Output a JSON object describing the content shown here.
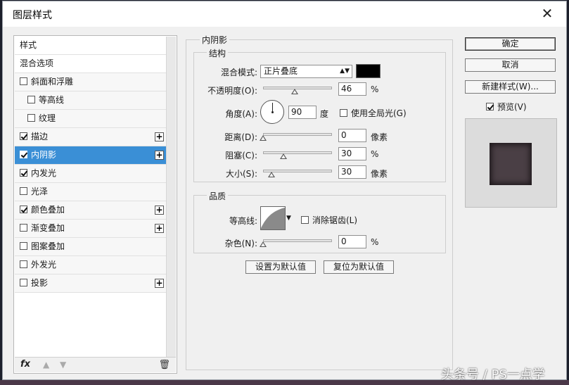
{
  "dialog": {
    "title": "图层样式",
    "close_label": "✕"
  },
  "styles": {
    "items": [
      {
        "label": "样式",
        "checkbox": false,
        "checked": false,
        "plus": false,
        "indent": false,
        "header": true
      },
      {
        "label": "混合选项",
        "checkbox": false,
        "checked": false,
        "plus": false,
        "indent": false,
        "header": true
      },
      {
        "label": "斜面和浮雕",
        "checkbox": true,
        "checked": false,
        "plus": false,
        "indent": false
      },
      {
        "label": "等高线",
        "checkbox": true,
        "checked": false,
        "plus": false,
        "indent": true
      },
      {
        "label": "纹理",
        "checkbox": true,
        "checked": false,
        "plus": false,
        "indent": true
      },
      {
        "label": "描边",
        "checkbox": true,
        "checked": true,
        "plus": true,
        "indent": false
      },
      {
        "label": "内阴影",
        "checkbox": true,
        "checked": true,
        "plus": true,
        "indent": false,
        "selected": true
      },
      {
        "label": "内发光",
        "checkbox": true,
        "checked": true,
        "plus": false,
        "indent": false
      },
      {
        "label": "光泽",
        "checkbox": true,
        "checked": false,
        "plus": false,
        "indent": false
      },
      {
        "label": "颜色叠加",
        "checkbox": true,
        "checked": true,
        "plus": true,
        "indent": false
      },
      {
        "label": "渐变叠加",
        "checkbox": true,
        "checked": false,
        "plus": true,
        "indent": false
      },
      {
        "label": "图案叠加",
        "checkbox": true,
        "checked": false,
        "plus": false,
        "indent": false
      },
      {
        "label": "外发光",
        "checkbox": true,
        "checked": false,
        "plus": false,
        "indent": false
      },
      {
        "label": "投影",
        "checkbox": true,
        "checked": false,
        "plus": true,
        "indent": false
      }
    ],
    "footer_fx": "fx"
  },
  "inner_shadow": {
    "section_title": "内阴影",
    "structure": {
      "title": "结构",
      "blend_mode_label": "混合模式:",
      "blend_mode_value": "正片叠底",
      "opacity_label": "不透明度(O):",
      "opacity_value": "46",
      "opacity_unit": "%",
      "opacity_slider": 0.46,
      "angle_label": "角度(A):",
      "angle_value": "90",
      "angle_unit": "度",
      "global_light_label": "使用全局光(G)",
      "distance_label": "距离(D):",
      "distance_value": "0",
      "distance_unit": "像素",
      "distance_slider": 0.0,
      "choke_label": "阻塞(C):",
      "choke_value": "30",
      "choke_unit": "%",
      "choke_slider": 0.3,
      "size_label": "大小(S):",
      "size_value": "30",
      "size_unit": "像素",
      "size_slider": 0.12
    },
    "quality": {
      "title": "品质",
      "contour_label": "等高线:",
      "anti_alias_label": "消除锯齿(L)",
      "noise_label": "杂色(N):",
      "noise_value": "0",
      "noise_unit": "%",
      "noise_slider": 0.0
    },
    "make_default_label": "设置为默认值",
    "reset_default_label": "复位为默认值"
  },
  "actions": {
    "ok_label": "确定",
    "cancel_label": "取消",
    "new_style_label": "新建样式(W)...",
    "preview_label": "预览(V)"
  },
  "colors": {
    "selected_bg": "#3a8fd6",
    "shadow_color": "#000000",
    "preview_fill": "#4a3f45"
  },
  "watermark": "头条号 / PS一点学"
}
